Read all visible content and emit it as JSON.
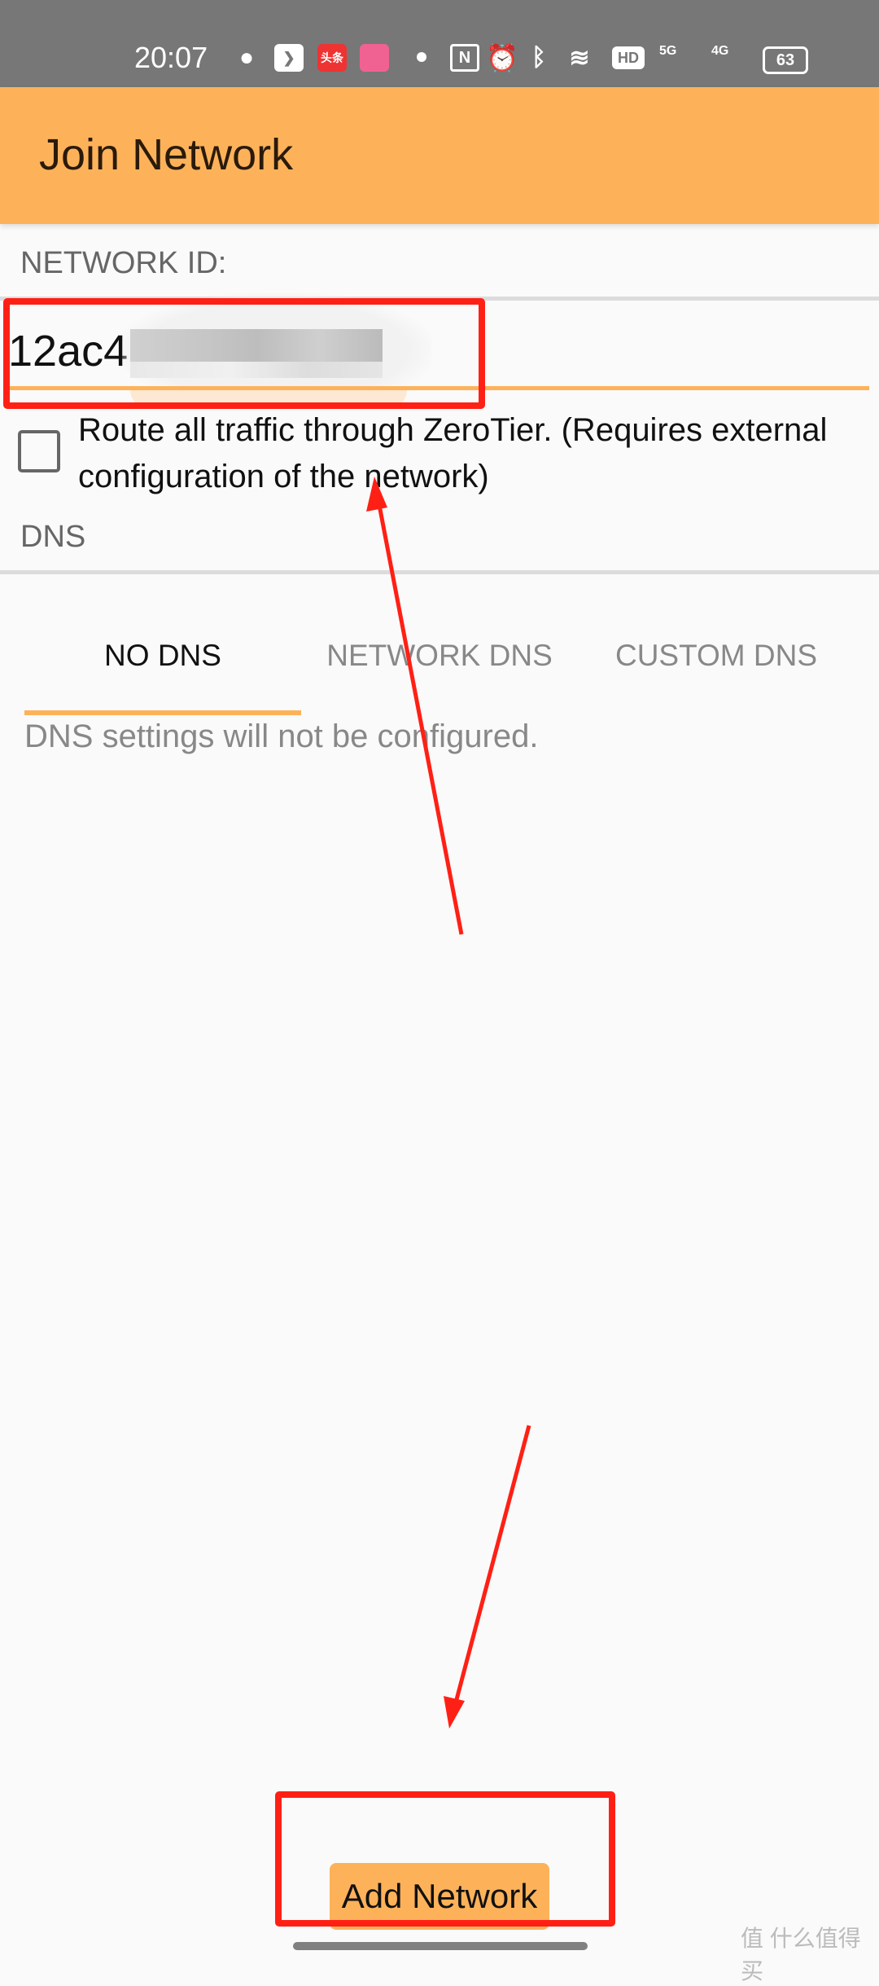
{
  "status_bar": {
    "time": "20:07",
    "battery": "63",
    "network_labels": [
      "5G",
      "4G"
    ],
    "hd_label": "HD",
    "app_icons": [
      "wechat-icon",
      "feather-app-icon",
      "toutiao-icon",
      "bilibili-icon"
    ],
    "toutiao_label": "头条"
  },
  "toolbar": {
    "title": "Join Network"
  },
  "form": {
    "network_id_label": "NETWORK ID:",
    "network_id_value": "12ac4",
    "route_all_label": "Route all traffic through ZeroTier. (Requires external configuration of the network)",
    "route_all_checked": false,
    "dns_label": "DNS",
    "dns_tabs": [
      {
        "label": "NO DNS",
        "selected": true
      },
      {
        "label": "NETWORK DNS",
        "selected": false
      },
      {
        "label": "CUSTOM DNS",
        "selected": false
      }
    ],
    "dns_message": "DNS settings will not be configured."
  },
  "actions": {
    "add_network": "Add Network"
  },
  "watermark": "值 什么值得买",
  "colors": {
    "accent": "#fdb25a",
    "annotation": "#ff2015",
    "status_bar": "#777777"
  }
}
